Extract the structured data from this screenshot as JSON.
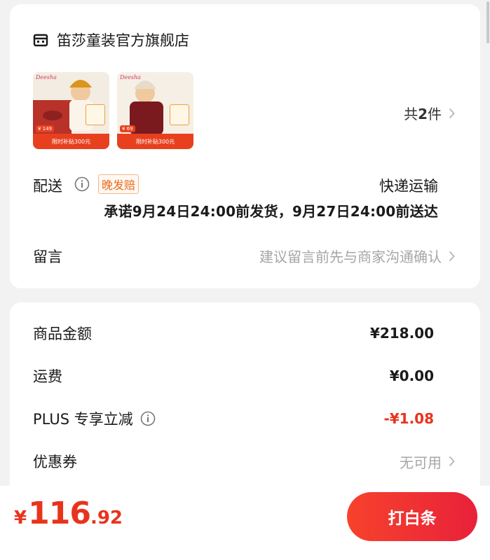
{
  "shop": {
    "name": "笛莎童装官方旗舰店",
    "products": [
      {
        "brand": "Deesha",
        "price_tag": "¥ 149",
        "banner": "限时补贴300元"
      },
      {
        "brand": "Deesha",
        "price_tag": "¥ 69",
        "banner": "限时补贴300元"
      }
    ],
    "count_prefix": "共",
    "count_num": "2",
    "count_suffix": "件"
  },
  "shipping": {
    "label": "配送",
    "late_tag": "晚发赔",
    "method": "快递运输",
    "promise": "承诺9月24日24:00前发货，9月27日24:00前送达"
  },
  "message": {
    "label": "留言",
    "placeholder": "建议留言前先与商家沟通确认"
  },
  "summary": {
    "goods_label": "商品金额",
    "goods_value": "¥218.00",
    "freight_label": "运费",
    "freight_value": "¥0.00",
    "plus_label": "PLUS 专享立减",
    "plus_value": "-¥1.08",
    "coupon_label": "优惠券",
    "coupon_value": "无可用"
  },
  "footer": {
    "currency": "¥",
    "total_int": "116",
    "total_dec": ".92",
    "pay_label": "打白条"
  },
  "colors": {
    "accent": "#e8341c",
    "late_tag": "#e86a1a",
    "muted": "#a6a6a6"
  }
}
